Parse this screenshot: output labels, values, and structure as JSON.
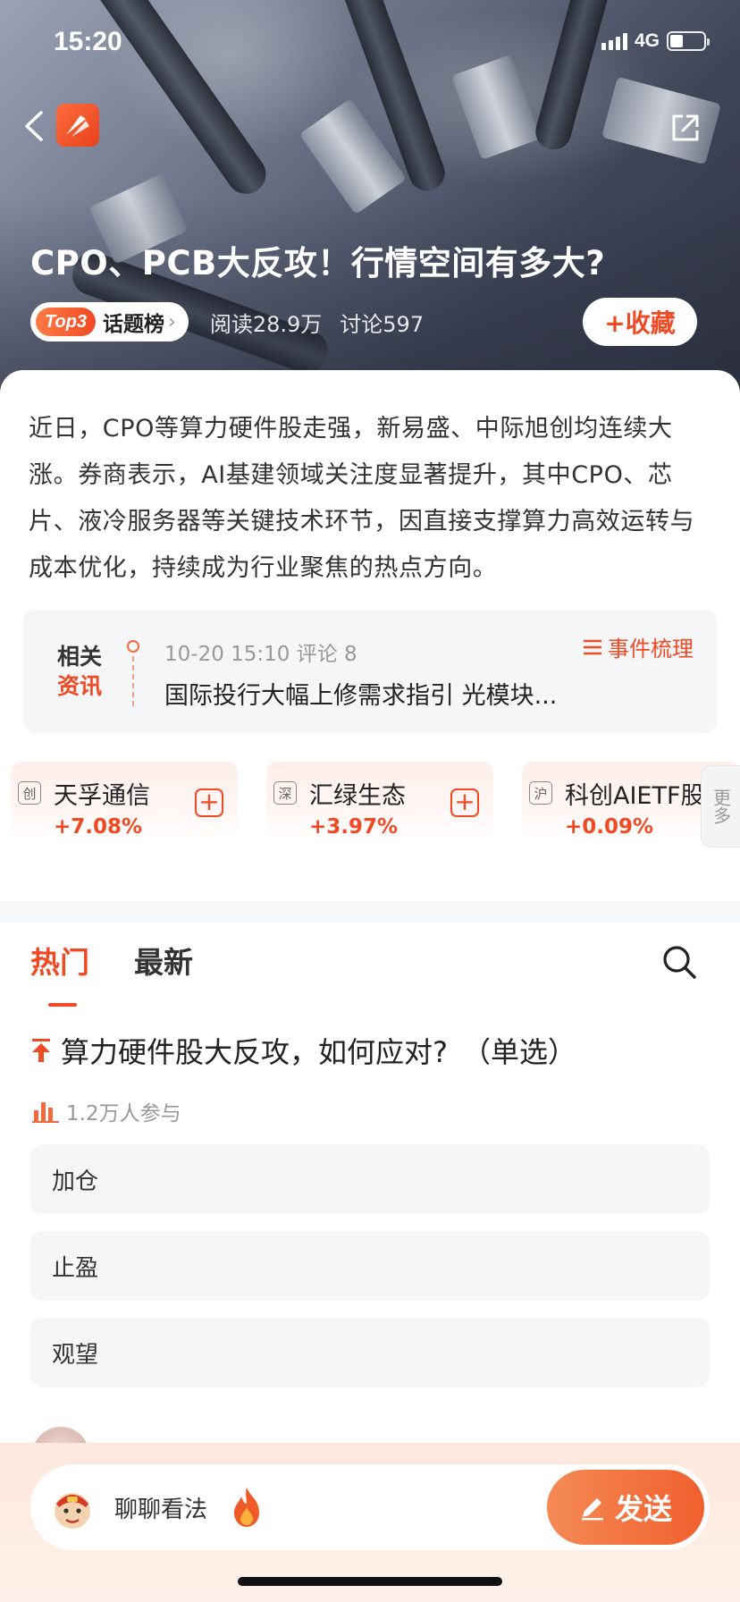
{
  "status_bar": {
    "time": "15:20",
    "network": "4G",
    "battery_level": 0.4
  },
  "header": {
    "title": "CPO、PCB大反攻！行情空间有多大?",
    "rank_badge": "Top3",
    "rank_label": "话题榜",
    "reads": "阅读28.9万",
    "discussions": "讨论597",
    "favorite_label": "+收藏"
  },
  "intro": {
    "text": "近日，CPO等算力硬件股走强，新易盛、中际旭创均连续大涨。券商表示，AI基建领域关注度显著提升，其中CPO、芯片、液冷服务器等关键技术环节，因直接支撑算力高效运转与成本优化，持续成为行业聚焦的热点方向。"
  },
  "related_news": {
    "tag_line1": "相关",
    "tag_line2": "资讯",
    "meta": "10-20 15:10 评论 8",
    "title": "国际投行大幅上修需求指引 光模块...",
    "event_link": "事件梳理"
  },
  "stocks": [
    {
      "market": "创",
      "name": "天孚通信",
      "change": "+7.08%"
    },
    {
      "market": "深",
      "name": "汇绿生态",
      "change": "+3.97%"
    },
    {
      "market": "沪",
      "name": "科创AIETF股",
      "change": "+0.09%"
    }
  ],
  "more_label": "更多",
  "tabs": [
    {
      "label": "热门",
      "active": true
    },
    {
      "label": "最新",
      "active": false
    }
  ],
  "poll": {
    "question": "算力硬件股大反攻，如何应对?　（单选）",
    "participants": "1.2万人参与",
    "options": [
      "加仓",
      "止盈",
      "观望"
    ]
  },
  "bottom_bar": {
    "placeholder": "聊聊看法",
    "send_label": "发送"
  },
  "colors": {
    "accent": "#f04a24",
    "accent_light": "#f58a56",
    "background": "#ffffff",
    "card_bg": "#f5f6f8"
  }
}
